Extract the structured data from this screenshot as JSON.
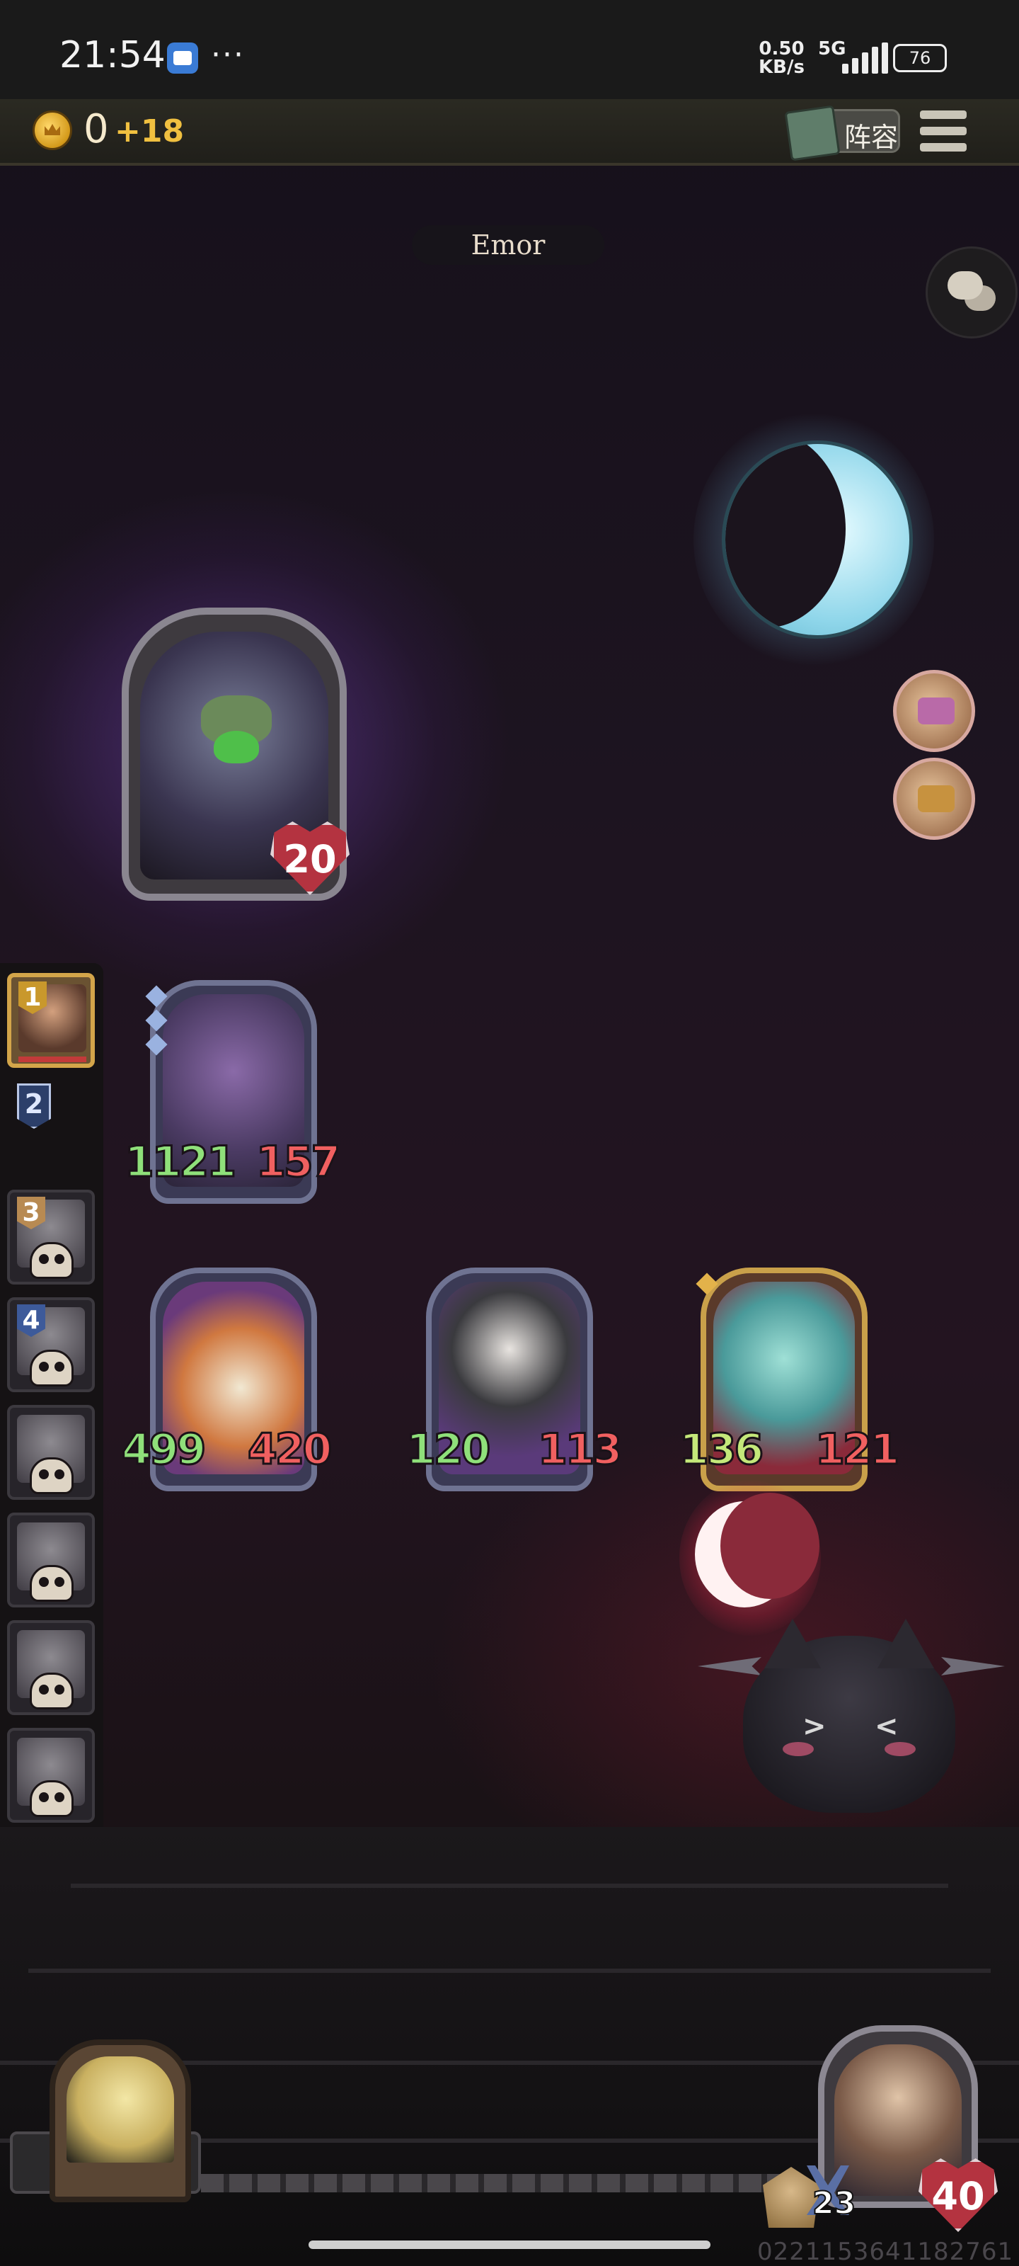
{
  "status_bar": {
    "time": "21:54",
    "dots": "···",
    "net_speed_value": "0.50",
    "net_speed_unit": "KB/s",
    "network": "5G",
    "battery": "76"
  },
  "top_bar": {
    "gold": "0",
    "income": "+18",
    "lineup_label": "阵容"
  },
  "opponent": {
    "name": "Emor",
    "hp": "20"
  },
  "player": {
    "armor": "23",
    "hp": "40"
  },
  "board": {
    "row1": [
      {
        "attack": "1121",
        "health": "157"
      }
    ],
    "row2": [
      {
        "attack": "499",
        "health": "420"
      },
      {
        "attack": "120",
        "health": "113"
      },
      {
        "attack": "136",
        "health": "121"
      }
    ]
  },
  "ranking": {
    "slots": [
      {
        "rank": "1"
      },
      {
        "rank": "2"
      },
      {
        "rank": "3"
      },
      {
        "rank": "4"
      }
    ]
  },
  "footer": {
    "uid": "0221153641182761"
  },
  "colors": {
    "attack": "#8fe07a",
    "health": "#f06060",
    "gold": "#f0c040",
    "active_slot": "#d3a54a"
  }
}
